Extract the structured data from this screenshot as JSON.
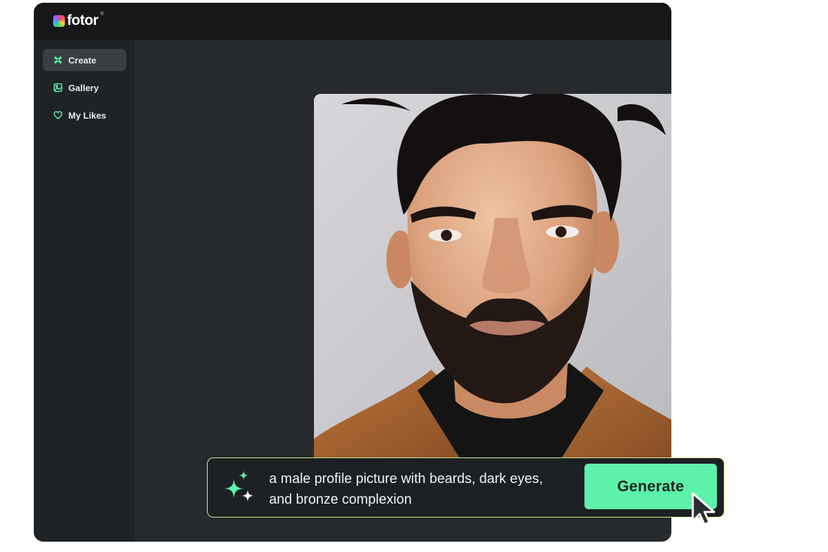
{
  "app": {
    "logo_text": "fotor",
    "logo_mark": "®"
  },
  "sidebar": {
    "items": [
      {
        "label": "Create",
        "icon": "command-icon",
        "active": true
      },
      {
        "label": "Gallery",
        "icon": "gallery-icon",
        "active": false
      },
      {
        "label": "My Likes",
        "icon": "heart-icon",
        "active": false
      }
    ]
  },
  "prompt": {
    "text": "a male profile picture with beards, dark eyes, and bronze complexion",
    "generate_label": "Generate",
    "icon": "sparkle-icon"
  },
  "colors": {
    "accent_green": "#5cf2a9",
    "prompt_border": "#d7ec8f",
    "topbar": "#151719",
    "sidebar": "#1f2326",
    "main": "#262a2d"
  }
}
